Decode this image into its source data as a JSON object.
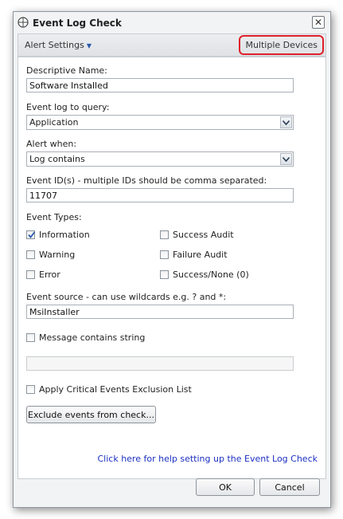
{
  "window": {
    "title": "Event Log Check",
    "close_glyph": "✕"
  },
  "toolbar": {
    "alert_settings": "Alert Settings",
    "multiple_devices": "Multiple Devices"
  },
  "form": {
    "descriptive_name_label": "Descriptive Name:",
    "descriptive_name_value": "Software Installed",
    "event_log_label": "Event log to query:",
    "event_log_value": "Application",
    "alert_when_label": "Alert when:",
    "alert_when_value": "Log contains",
    "event_ids_label": "Event ID(s) - multiple IDs should be comma separated:",
    "event_ids_value": "11707",
    "event_types_label": "Event Types:",
    "event_types": [
      {
        "label": "Information",
        "checked": true
      },
      {
        "label": "Success Audit",
        "checked": false
      },
      {
        "label": "Warning",
        "checked": false
      },
      {
        "label": "Failure Audit",
        "checked": false
      },
      {
        "label": "Error",
        "checked": false
      },
      {
        "label": "Success/None (0)",
        "checked": false
      }
    ],
    "event_source_label": "Event source - can use wildcards e.g. ? and *:",
    "event_source_value": "MsiInstaller",
    "message_contains_label": "Message contains string",
    "message_contains_checked": false,
    "message_value": "",
    "apply_exclusion_label": "Apply Critical Events Exclusion List",
    "apply_exclusion_checked": false,
    "exclude_button": "Exclude events from check...",
    "help_link": "Click here for help setting up the Event Log Check"
  },
  "footer": {
    "ok": "OK",
    "cancel": "Cancel"
  },
  "colors": {
    "highlight": "#e0202a",
    "link": "#1b2fc2",
    "check": "#2a5aa8"
  }
}
